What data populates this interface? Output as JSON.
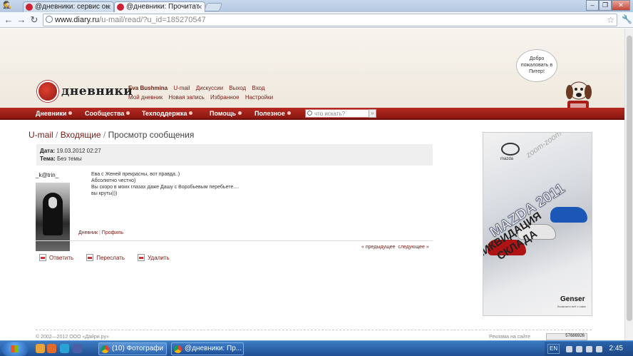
{
  "browser": {
    "tabs": [
      {
        "title": "@дневники: сервис он",
        "active": false
      },
      {
        "title": "@дневники: Прочитат",
        "active": true
      }
    ],
    "url_host": "www.diary.ru",
    "url_path": "/u-mail/read/?u_id=185270547",
    "window_buttons": [
      "–",
      "❐",
      "✕"
    ]
  },
  "site": {
    "logo_text": "дневники",
    "user_name": "Eva Bushmina",
    "user_links_row1": [
      "U-mail",
      "Дискуссии",
      "Выход",
      "Вход"
    ],
    "user_links_row2": [
      "Мой дневник",
      "Новая запись",
      "Избранное",
      "Настройки"
    ],
    "mascot_bubble": "Добро пожаловать в Питер!",
    "menu": [
      "Дневники",
      "Сообщества",
      "Техподдержка",
      "Помощь",
      "Полезное"
    ],
    "search_placeholder": "что искать?",
    "search_go": "»"
  },
  "breadcrumb": {
    "link1": "U-mail",
    "sep1": " / ",
    "link2": "Входящие",
    "sep2": " / ",
    "current": "Просмотр сообщения"
  },
  "message": {
    "date_label": "Дата:",
    "date_value": "19.03.2012 02:27",
    "subject_label": "Тема:",
    "subject_value": "Без темы",
    "author": "_k@trin_",
    "lines": [
      "Ева с Женей прекрасны, вот правда..)",
      "Абсолютно честно)",
      "Вы скоро в моих глазах даже Дашу с Воробьевым перебьете....",
      "вы круты)))"
    ],
    "link_diary": "Дневник",
    "link_sep": " | ",
    "link_profile": "Профиль",
    "prev": "« предыдущее",
    "next": "следующее »"
  },
  "actions": [
    {
      "label": "Ответить",
      "icon": "reply-icon"
    },
    {
      "label": "Переслать",
      "icon": "forward-icon"
    },
    {
      "label": "Удалить",
      "icon": "trash-icon"
    }
  ],
  "ad": {
    "brand": "mazda",
    "tagline": "zoom-zoom",
    "headline": "MAZDA 2011",
    "sale_line1": "ЛИКВИДАЦИЯ",
    "sale_line2": "СКЛАДА",
    "dealer": "Genser",
    "dealer_sub": "Возможно всё с нами"
  },
  "footer": {
    "copyright": "© 2002—2012 ООО «Дайри.ру»",
    "ad_link": "Реклама на сайте",
    "counter": "57686926"
  },
  "taskbar": {
    "buttons": [
      "(10) Фотографи",
      "@дневники: Пр..."
    ],
    "lang": "EN",
    "clock": "2:45"
  },
  "colors": {
    "brand_red": "#a11d15",
    "link_red": "#7a1a13",
    "taskbar_blue": "#2d65b0"
  }
}
